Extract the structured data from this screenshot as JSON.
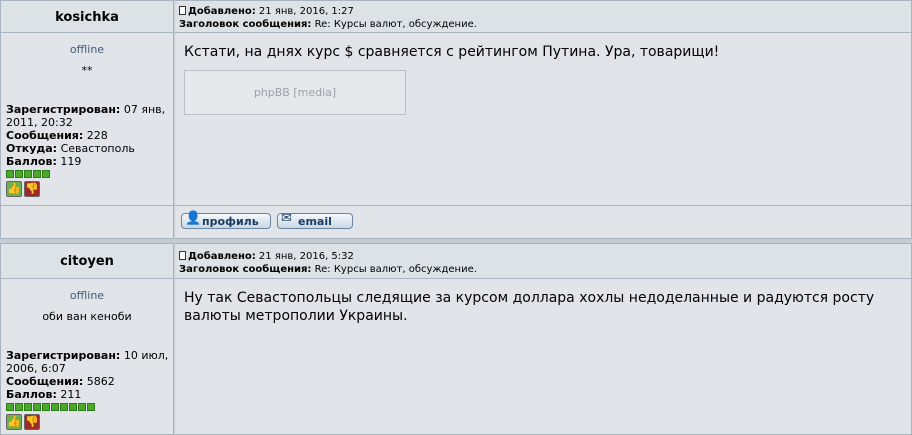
{
  "posts": [
    {
      "author": "kosichka",
      "status": "offline",
      "rank": "**",
      "posted_label": "Добавлено:",
      "posted_value": "21 янв, 2016, 1:27",
      "subject_label": "Заголовок сообщения:",
      "subject_value": "Re: Курсы валют, обсуждение.",
      "registered_label": "Зарегистрирован:",
      "registered_value": "07 янв, 2011, 20:32",
      "messages_label": "Сообщения:",
      "messages_value": "228",
      "from_label": "Откуда:",
      "from_value": "Севастополь",
      "points_label": "Баллов:",
      "points_value": "119",
      "reputation_dots": 5,
      "message": "Кстати, на днях курс $ сравняется с рейтингом Путина. Ура, товарищи!",
      "media_placeholder": "phpBB [media]",
      "profile_button": "профиль",
      "email_button": "email"
    },
    {
      "author": "citoyen",
      "status": "offline",
      "rank": "оби ван кеноби",
      "posted_label": "Добавлено:",
      "posted_value": "21 янв, 2016, 5:32",
      "subject_label": "Заголовок сообщения:",
      "subject_value": "Re: Курсы валют, обсуждение.",
      "registered_label": "Зарегистрирован:",
      "registered_value": "10 июл, 2006, 6:07",
      "messages_label": "Сообщения:",
      "messages_value": "5862",
      "points_label": "Баллов:",
      "points_value": "211",
      "reputation_dots": 10,
      "message": "Ну так Севастопольцы следящие за курсом доллара хохлы недоделанные и радуются росту валюты метрополии Украины."
    }
  ],
  "icons": {
    "post_icon": "document-icon",
    "thumb_up": "thumbs-up-icon",
    "thumb_down": "thumbs-down-icon",
    "profile_icon": "user-icon",
    "email_icon": "envelope-icon"
  },
  "colors": {
    "background": "#c5ccd3",
    "row": "#e1e5ea",
    "header": "#dde2e7",
    "status_text": "#3f5a75",
    "reputation_green": "#4aa82a"
  }
}
